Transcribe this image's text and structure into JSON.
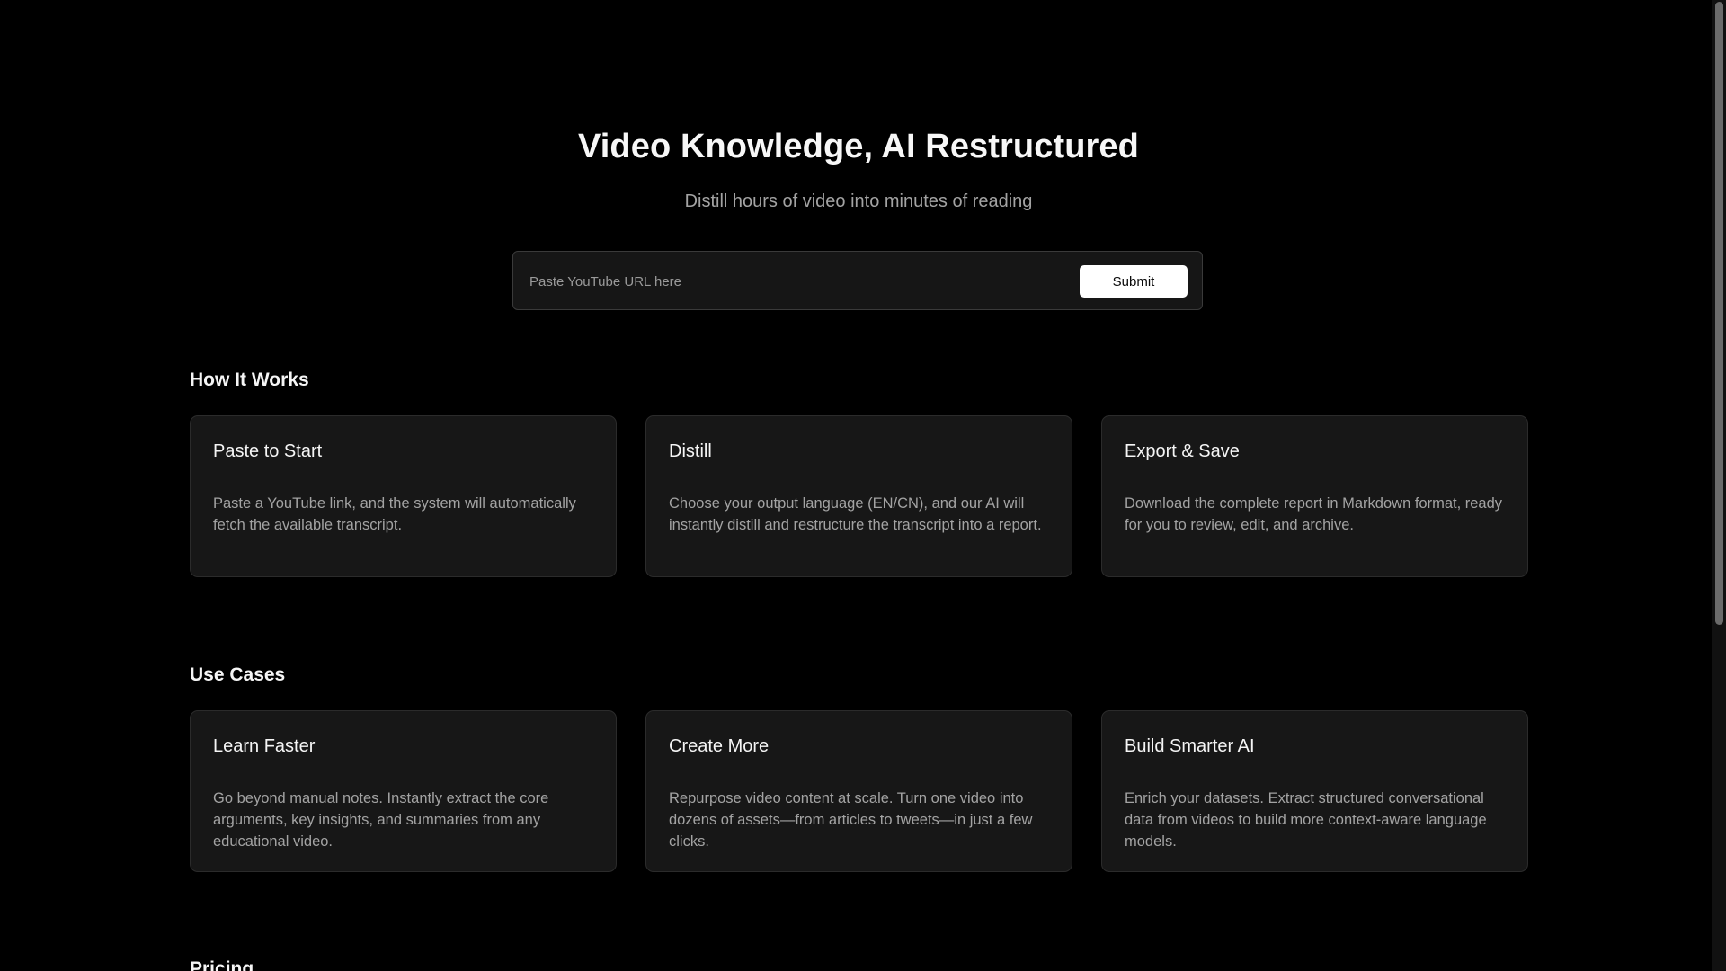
{
  "hero": {
    "title": "Video Knowledge, AI Restructured",
    "subtitle": "Distill hours of video into minutes of reading"
  },
  "url_form": {
    "value": "",
    "placeholder": "Paste YouTube URL here",
    "submit_label": "Submit"
  },
  "how_it_works": {
    "heading": "How It Works",
    "cards": [
      {
        "title": "Paste to Start",
        "body": "Paste a YouTube link, and the system will automatically fetch the available transcript."
      },
      {
        "title": "Distill",
        "body": "Choose your output language (EN/CN), and our AI will instantly distill and restructure the transcript into a report."
      },
      {
        "title": "Export & Save",
        "body": "Download the complete report in Markdown format, ready for you to review, edit, and archive."
      }
    ]
  },
  "use_cases": {
    "heading": "Use Cases",
    "cards": [
      {
        "title": "Learn Faster",
        "body": "Go beyond manual notes. Instantly extract the core arguments, key insights, and summaries from any educational video."
      },
      {
        "title": "Create More",
        "body": "Repurpose video content at scale. Turn one video into dozens of assets—from articles to tweets—in just a few clicks."
      },
      {
        "title": "Build Smarter AI",
        "body": "Enrich your datasets. Extract structured conversational data from videos to build more context-aware language models."
      }
    ]
  },
  "pricing": {
    "heading": "Pricing"
  },
  "colors": {
    "background": "#000000",
    "card_background": "#171717",
    "card_border": "#2b2b2b",
    "muted_text": "#a3a3a3",
    "button_background": "#ffffff"
  }
}
